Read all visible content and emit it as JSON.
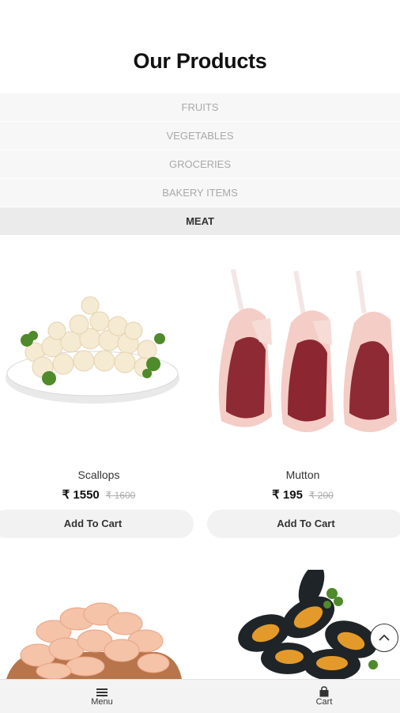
{
  "page_title": "Our Products",
  "categories": [
    {
      "label": "FRUITS",
      "active": false
    },
    {
      "label": "VEGETABLES",
      "active": false
    },
    {
      "label": "GROCERIES",
      "active": false
    },
    {
      "label": "BAKERY ITEMS",
      "active": false
    },
    {
      "label": "MEAT",
      "active": true
    }
  ],
  "products": [
    {
      "name": "Scallops",
      "price": "₹ 1550",
      "old_price": "₹ 1600",
      "button": "Add To Cart",
      "image": "scallops-bowl"
    },
    {
      "name": "Mutton",
      "price": "₹ 195",
      "old_price": "₹ 200",
      "button": "Add To Cart",
      "image": "mutton-chops"
    },
    {
      "name": "",
      "price": "",
      "old_price": "",
      "button": "",
      "image": "shrimp-bowl"
    },
    {
      "name": "",
      "price": "",
      "old_price": "",
      "button": "",
      "image": "mussels"
    }
  ],
  "scroll_top_icon": "chevron-up-icon",
  "bottom_nav": {
    "menu_label": "Menu",
    "menu_icon": "hamburger-icon",
    "cart_label": "Cart",
    "cart_icon": "shopping-bag-icon"
  }
}
